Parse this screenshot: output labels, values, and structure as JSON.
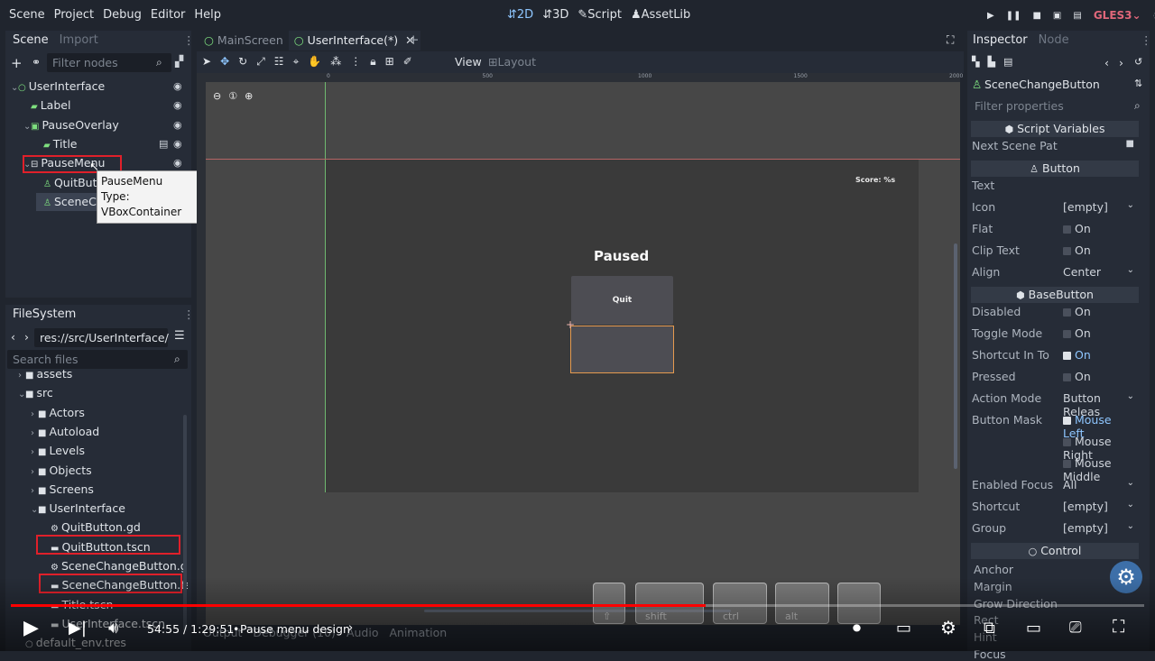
{
  "menu": [
    "Scene",
    "Project",
    "Debug",
    "Editor",
    "Help"
  ],
  "workspaces": [
    {
      "icon": "⇵",
      "label": "2D",
      "active": true
    },
    {
      "icon": "⇵",
      "label": "3D"
    },
    {
      "icon": "✎",
      "label": "Script"
    },
    {
      "icon": "♟",
      "label": "AssetLib"
    }
  ],
  "renderer": "GLES3",
  "scene_dock": {
    "tabs": [
      "Scene",
      "Import"
    ],
    "filter_placeholder": "Filter nodes",
    "nodes": [
      {
        "label": "UserInterface",
        "icon": "○",
        "color": "#7ee07f",
        "indent": 0,
        "arrow": "⌄"
      },
      {
        "label": "Label",
        "icon": "▰",
        "color": "#7ee07f",
        "indent": 1,
        "arrow": ""
      },
      {
        "label": "PauseOverlay",
        "icon": "▣",
        "color": "#7ee07f",
        "indent": 1,
        "arrow": "⌄"
      },
      {
        "label": "Title",
        "icon": "▰",
        "color": "#7ee07f",
        "indent": 2,
        "arrow": ""
      },
      {
        "label": "PauseMenu",
        "icon": "⊟",
        "color": "#dfe3e8",
        "indent": 1,
        "arrow": "⌄"
      },
      {
        "label": "QuitButt",
        "icon": "♙",
        "color": "#7ee07f",
        "indent": 2,
        "arrow": ""
      },
      {
        "label": "SceneCh",
        "icon": "♙",
        "color": "#7ee07f",
        "indent": 2,
        "arrow": ""
      }
    ]
  },
  "tooltip": {
    "line1": "PauseMenu",
    "line2": "Type: VBoxContainer"
  },
  "filesystem": {
    "title": "FileSystem",
    "path": "res://src/UserInterface/",
    "search_placeholder": "Search files",
    "items": [
      {
        "label": "assets",
        "icon": "■",
        "indent": 0,
        "arrow": "›"
      },
      {
        "label": "src",
        "icon": "■",
        "indent": 0,
        "arrow": "⌄"
      },
      {
        "label": "Actors",
        "icon": "■",
        "indent": 1,
        "arrow": "›"
      },
      {
        "label": "Autoload",
        "icon": "■",
        "indent": 1,
        "arrow": "›"
      },
      {
        "label": "Levels",
        "icon": "■",
        "indent": 1,
        "arrow": "›"
      },
      {
        "label": "Objects",
        "icon": "■",
        "indent": 1,
        "arrow": "›"
      },
      {
        "label": "Screens",
        "icon": "■",
        "indent": 1,
        "arrow": "›"
      },
      {
        "label": "UserInterface",
        "icon": "■",
        "indent": 1,
        "arrow": "⌄"
      },
      {
        "label": "QuitButton.gd",
        "icon": "⚙",
        "indent": 2,
        "arrow": ""
      },
      {
        "label": "QuitButton.tscn",
        "icon": "▬",
        "indent": 2,
        "arrow": ""
      },
      {
        "label": "SceneChangeButton.gd",
        "icon": "⚙",
        "indent": 2,
        "arrow": ""
      },
      {
        "label": "SceneChangeButton.tsc",
        "icon": "▬",
        "indent": 2,
        "arrow": ""
      },
      {
        "label": "Title.tscn",
        "icon": "▬",
        "indent": 2,
        "arrow": ""
      },
      {
        "label": "UserInterface.tscn",
        "icon": "▬",
        "indent": 2,
        "arrow": ""
      },
      {
        "label": "default_env.tres",
        "icon": "○",
        "indent": 0,
        "arrow": ""
      }
    ]
  },
  "editor_tabs": [
    {
      "label": "MainScreen",
      "active": false
    },
    {
      "label": "UserInterface(*)",
      "active": true
    }
  ],
  "toolbar": {
    "view": "View",
    "layout": "Layout"
  },
  "ruler": [
    "0",
    "500",
    "1000",
    "1500",
    "2000"
  ],
  "canvas": {
    "score": "Score: %s",
    "paused": "Paused",
    "quit": "Quit"
  },
  "bottom_tabs": [
    "Output",
    "Debugger (10)",
    "Audio",
    "Animation"
  ],
  "inspector": {
    "tabs": [
      "Inspector",
      "Node"
    ],
    "node": "SceneChangeButton",
    "filter_placeholder": "Filter properties",
    "rows": [
      {
        "type": "section",
        "label": "Script Variables",
        "icon": "⬢"
      },
      {
        "type": "prop",
        "k": "Next Scene Pat",
        "v": "",
        "folder": true
      },
      {
        "type": "section",
        "label": "Button",
        "icon": "♙"
      },
      {
        "type": "prop",
        "k": "Text",
        "v": ""
      },
      {
        "type": "prop",
        "k": "Icon",
        "v": "[empty]",
        "dd": true
      },
      {
        "type": "prop",
        "k": "Flat",
        "v": "On",
        "cb": false
      },
      {
        "type": "prop",
        "k": "Clip Text",
        "v": "On",
        "cb": false
      },
      {
        "type": "prop",
        "k": "Align",
        "v": "Center",
        "dd": true
      },
      {
        "type": "section",
        "label": "BaseButton",
        "icon": "⬢"
      },
      {
        "type": "prop",
        "k": "Disabled",
        "v": "On",
        "cb": false
      },
      {
        "type": "prop",
        "k": "Toggle Mode",
        "v": "On",
        "cb": false
      },
      {
        "type": "prop",
        "k": "Shortcut In To",
        "v": "On",
        "cb": true
      },
      {
        "type": "prop",
        "k": "Pressed",
        "v": "On",
        "cb": false
      },
      {
        "type": "prop",
        "k": "Action Mode",
        "v": "Button Releas",
        "dd": true
      },
      {
        "type": "prop",
        "k": "Button Mask",
        "v": "Mouse Left",
        "cb": true
      },
      {
        "type": "prop",
        "k": "",
        "v": "Mouse Right",
        "cb": false
      },
      {
        "type": "prop",
        "k": "",
        "v": "Mouse Middle",
        "cb": false
      },
      {
        "type": "prop",
        "k": "Enabled Focus",
        "v": "All",
        "dd": true
      },
      {
        "type": "prop",
        "k": "Shortcut",
        "v": "[empty]",
        "dd": true
      },
      {
        "type": "prop",
        "k": "Group",
        "v": "[empty]",
        "dd": true
      },
      {
        "type": "section",
        "label": "Control",
        "icon": "○"
      },
      {
        "type": "sub",
        "k": "Anchor"
      },
      {
        "type": "sub",
        "k": "Margin"
      },
      {
        "type": "sub",
        "k": "Grow Direction"
      },
      {
        "type": "sub",
        "k": "Rect"
      },
      {
        "type": "sub",
        "k": "Hint"
      },
      {
        "type": "sub",
        "k": "Focus"
      }
    ]
  },
  "keys": [
    "⇧",
    "shift",
    "ctrl",
    "alt",
    ""
  ],
  "video": {
    "time": "54:55 / 1:29:51",
    "sep": "•",
    "chapter": "Pause menu design",
    "chapter_arrow": "›",
    "progress": 0.613
  }
}
